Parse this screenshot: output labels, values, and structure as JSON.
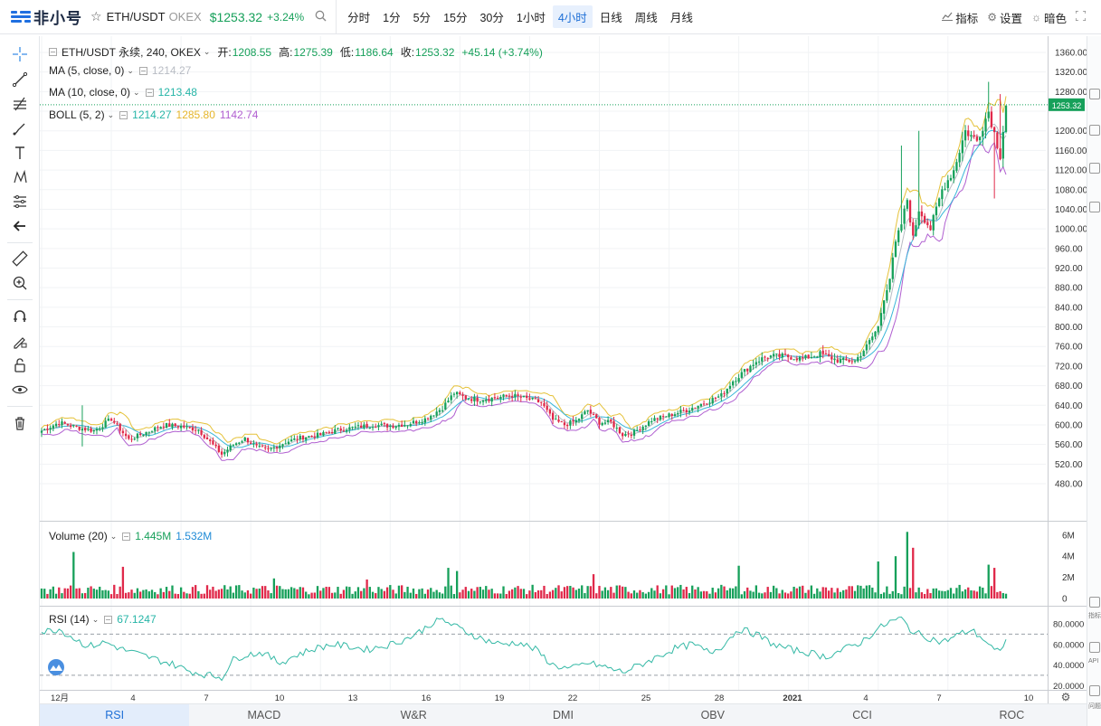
{
  "header": {
    "logo_text": "非小号",
    "pair": "ETH/USDT",
    "exchange": "OKEX",
    "last_price": "$1253.32",
    "change_pct": "+3.24%",
    "intervals": [
      "分时",
      "1分",
      "5分",
      "15分",
      "30分",
      "1小时",
      "4小时",
      "日线",
      "周线",
      "月线"
    ],
    "active_interval": "4小时",
    "indicators_label": "指标",
    "settings_label": "设置",
    "theme_label": "暗色"
  },
  "legend": {
    "symbol_line": "ETH/USDT 永续, 240, OKEX",
    "open_label": "开:",
    "open": "1208.55",
    "high_label": "高:",
    "high": "1275.39",
    "low_label": "低:",
    "low": "1186.64",
    "close_label": "收:",
    "close": "1253.32",
    "change": "+45.14 (+3.74%)",
    "ma5_name": "MA (5, close, 0)",
    "ma5_value": "1214.27",
    "ma10_name": "MA (10, close, 0)",
    "ma10_value": "1213.48",
    "boll_name": "BOLL (5, 2)",
    "boll_mid": "1214.27",
    "boll_upper": "1285.80",
    "boll_lower": "1142.74",
    "volume_name": "Volume (20)",
    "volume_value": "1.445M",
    "volume_ma": "1.532M",
    "rsi_name": "RSI (14)",
    "rsi_value": "67.1247"
  },
  "bottom_tabs": [
    "RSI",
    "MACD",
    "W&R",
    "DMI",
    "OBV",
    "CCI",
    "ROC"
  ],
  "active_tab": "RSI",
  "right_edge": {
    "label_1": "指标",
    "label_2": "API",
    "label_3": "问题"
  },
  "colors": {
    "up": "#16a05a",
    "down": "#e0294a",
    "ma5": "#b8bcc4",
    "ma10": "#26b5a7",
    "boll_upper": "#e5c23a",
    "boll_lower": "#b05fd0",
    "boll_mid": "#38b6d8",
    "rsi": "#35b9a6",
    "accent": "#1e6fd6"
  },
  "chart_data": {
    "type": "candlestick",
    "title": "ETH/USDT 永续, 240, OKEX",
    "price_axis": {
      "min": 460,
      "max": 1380,
      "ticks": [
        "1360.00",
        "1320.00",
        "1280.00",
        "1240.00",
        "1200.00",
        "1160.00",
        "1120.00",
        "1080.00",
        "1040.00",
        "1000.00",
        "960.00",
        "920.00",
        "880.00",
        "840.00",
        "800.00",
        "760.00",
        "720.00",
        "680.00",
        "640.00",
        "600.00",
        "560.00",
        "520.00",
        "480.00"
      ]
    },
    "last_price_tag": "1253.32",
    "x_tick_labels": [
      "12月",
      "4",
      "7",
      "10",
      "13",
      "16",
      "19",
      "22",
      "25",
      "28",
      "2021",
      "4",
      "7",
      "10"
    ],
    "volume_axis": {
      "ticks": [
        "6M",
        "4M",
        "2M",
        "0"
      ]
    },
    "rsi_axis": {
      "ticks": [
        "80.0000",
        "60.0000",
        "40.0000",
        "20.0000"
      ],
      "bands": [
        70,
        30
      ]
    },
    "close_anchors": [
      [
        0,
        588
      ],
      [
        6,
        605
      ],
      [
        12,
        595
      ],
      [
        18,
        588
      ],
      [
        24,
        612
      ],
      [
        30,
        570
      ],
      [
        36,
        585
      ],
      [
        42,
        600
      ],
      [
        48,
        597
      ],
      [
        54,
        590
      ],
      [
        58,
        565
      ],
      [
        62,
        540
      ],
      [
        66,
        560
      ],
      [
        70,
        572
      ],
      [
        74,
        555
      ],
      [
        78,
        548
      ],
      [
        84,
        565
      ],
      [
        90,
        575
      ],
      [
        96,
        580
      ],
      [
        102,
        590
      ],
      [
        108,
        595
      ],
      [
        114,
        600
      ],
      [
        120,
        598
      ],
      [
        126,
        602
      ],
      [
        132,
        612
      ],
      [
        138,
        635
      ],
      [
        142,
        665
      ],
      [
        146,
        655
      ],
      [
        150,
        652
      ],
      [
        156,
        655
      ],
      [
        162,
        660
      ],
      [
        168,
        652
      ],
      [
        172,
        645
      ],
      [
        176,
        610
      ],
      [
        180,
        600
      ],
      [
        184,
        608
      ],
      [
        188,
        630
      ],
      [
        192,
        605
      ],
      [
        196,
        605
      ],
      [
        200,
        580
      ],
      [
        204,
        585
      ],
      [
        210,
        610
      ],
      [
        216,
        620
      ],
      [
        222,
        630
      ],
      [
        228,
        645
      ],
      [
        234,
        660
      ],
      [
        238,
        690
      ],
      [
        242,
        710
      ],
      [
        246,
        730
      ],
      [
        250,
        740
      ],
      [
        256,
        740
      ],
      [
        262,
        735
      ],
      [
        268,
        745
      ],
      [
        274,
        732
      ],
      [
        280,
        730
      ],
      [
        284,
        760
      ],
      [
        288,
        800
      ],
      [
        290,
        860
      ],
      [
        292,
        900
      ],
      [
        294,
        970
      ],
      [
        296,
        1010
      ],
      [
        298,
        1060
      ],
      [
        300,
        980
      ],
      [
        302,
        1040
      ],
      [
        306,
        1000
      ],
      [
        310,
        1080
      ],
      [
        314,
        1120
      ],
      [
        318,
        1200
      ],
      [
        322,
        1180
      ],
      [
        326,
        1240
      ],
      [
        328,
        1195
      ],
      [
        330,
        1150
      ],
      [
        332,
        1253
      ]
    ],
    "rsi_anchors": [
      [
        0,
        72
      ],
      [
        6,
        75
      ],
      [
        10,
        68
      ],
      [
        16,
        58
      ],
      [
        22,
        62
      ],
      [
        28,
        55
      ],
      [
        34,
        50
      ],
      [
        40,
        45
      ],
      [
        46,
        40
      ],
      [
        50,
        35
      ],
      [
        54,
        32
      ],
      [
        58,
        30
      ],
      [
        62,
        28
      ],
      [
        66,
        45
      ],
      [
        70,
        50
      ],
      [
        76,
        52
      ],
      [
        82,
        42
      ],
      [
        88,
        50
      ],
      [
        94,
        56
      ],
      [
        100,
        60
      ],
      [
        106,
        58
      ],
      [
        112,
        55
      ],
      [
        120,
        60
      ],
      [
        126,
        66
      ],
      [
        130,
        72
      ],
      [
        134,
        80
      ],
      [
        138,
        84
      ],
      [
        142,
        78
      ],
      [
        148,
        70
      ],
      [
        152,
        65
      ],
      [
        158,
        60
      ],
      [
        164,
        62
      ],
      [
        170,
        55
      ],
      [
        176,
        40
      ],
      [
        182,
        36
      ],
      [
        188,
        42
      ],
      [
        194,
        38
      ],
      [
        200,
        33
      ],
      [
        206,
        40
      ],
      [
        212,
        48
      ],
      [
        218,
        56
      ],
      [
        224,
        60
      ],
      [
        230,
        52
      ],
      [
        234,
        58
      ],
      [
        240,
        75
      ],
      [
        246,
        70
      ],
      [
        252,
        60
      ],
      [
        258,
        55
      ],
      [
        264,
        52
      ],
      [
        270,
        48
      ],
      [
        276,
        55
      ],
      [
        282,
        62
      ],
      [
        288,
        75
      ],
      [
        292,
        82
      ],
      [
        296,
        85
      ],
      [
        300,
        72
      ],
      [
        304,
        68
      ],
      [
        310,
        62
      ],
      [
        316,
        70
      ],
      [
        320,
        74
      ],
      [
        324,
        66
      ],
      [
        328,
        54
      ],
      [
        330,
        52
      ],
      [
        332,
        67
      ]
    ],
    "volume_spikes": [
      [
        11,
        4.4
      ],
      [
        28,
        3.0
      ],
      [
        80,
        1.9
      ],
      [
        112,
        1.8
      ],
      [
        140,
        2.9
      ],
      [
        143,
        2.6
      ],
      [
        190,
        2.3
      ],
      [
        240,
        3.1
      ],
      [
        288,
        3.5
      ],
      [
        294,
        4.0
      ],
      [
        298,
        6.3
      ],
      [
        300,
        4.8
      ],
      [
        326,
        3.2
      ],
      [
        328,
        2.9
      ]
    ]
  }
}
